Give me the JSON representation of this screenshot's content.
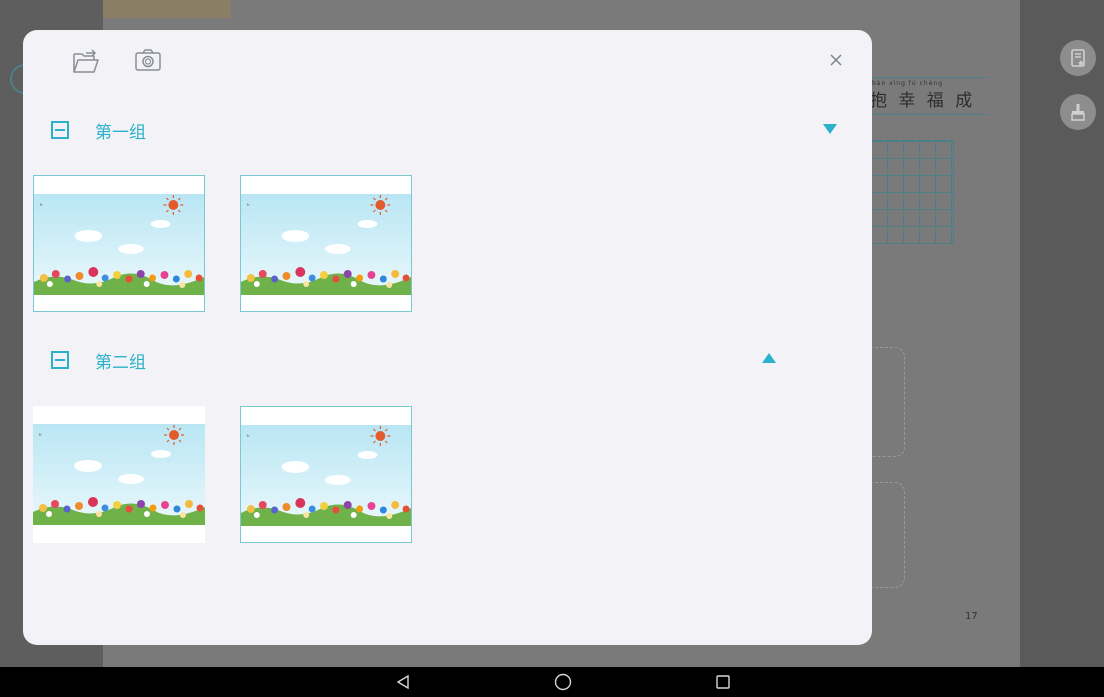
{
  "background_app": {
    "words": "抱 幸 福 成",
    "pinyin": "bào  xìng   fú   chéng",
    "page_number": "17",
    "tone_mark": "ǐ"
  },
  "dialog": {
    "toolbar": {
      "import_icon": "folder-import-icon",
      "camera_icon": "camera-icon",
      "close_label": "×"
    },
    "groups": [
      {
        "title": "第一组",
        "collapse_symbol": "−",
        "arrow": "down",
        "images": 2
      },
      {
        "title": "第二组",
        "collapse_symbol": "−",
        "arrow": "up",
        "images": 2
      }
    ]
  },
  "navbar": {
    "back_icon": "back-triangle-icon",
    "home_icon": "home-circle-icon",
    "recents_icon": "recents-square-icon"
  },
  "colors": {
    "accent": "#2bb1c9",
    "dialog_bg": "#f3f3f7",
    "overlay": "#6b6b6b"
  }
}
